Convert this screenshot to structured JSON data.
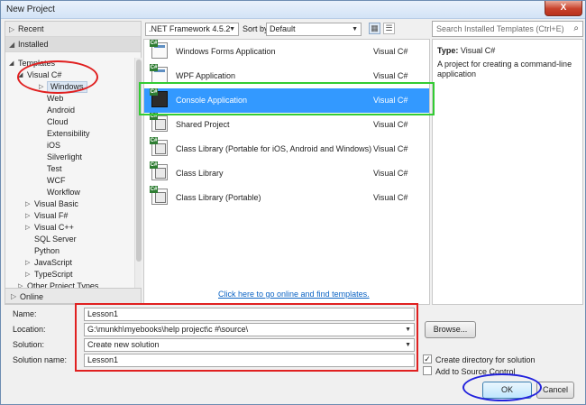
{
  "window": {
    "title": "New Project",
    "close_label": "X"
  },
  "left": {
    "recent_label": "Recent",
    "installed_label": "Installed",
    "online_label": "Online",
    "tree": [
      {
        "label": "Templates",
        "arrow": "◢"
      },
      {
        "label": "Visual C#",
        "arrow": "◢"
      },
      {
        "label": "Windows",
        "arrow": "▷",
        "selected": true
      },
      {
        "label": "Web"
      },
      {
        "label": "Android"
      },
      {
        "label": "Cloud"
      },
      {
        "label": "Extensibility"
      },
      {
        "label": "iOS"
      },
      {
        "label": "Silverlight"
      },
      {
        "label": "Test"
      },
      {
        "label": "WCF"
      },
      {
        "label": "Workflow"
      },
      {
        "label": "Visual Basic",
        "arrow": "▷"
      },
      {
        "label": "Visual F#",
        "arrow": "▷"
      },
      {
        "label": "Visual C++",
        "arrow": "▷"
      },
      {
        "label": "SQL Server"
      },
      {
        "label": "Python"
      },
      {
        "label": "JavaScript",
        "arrow": "▷"
      },
      {
        "label": "TypeScript",
        "arrow": "▷"
      },
      {
        "label": "Other Project Types",
        "arrow": "▷"
      }
    ]
  },
  "toolbar": {
    "framework_value": ".NET Framework 4.5.2",
    "sort_label": "Sort by:",
    "sort_value": "Default"
  },
  "templates": [
    {
      "name": "Windows Forms Application",
      "lang": "Visual C#",
      "icon": "winforms-app-icon"
    },
    {
      "name": "WPF Application",
      "lang": "Visual C#",
      "icon": "wpf-app-icon"
    },
    {
      "name": "Console Application",
      "lang": "Visual C#",
      "icon": "console-app-icon",
      "selected": true
    },
    {
      "name": "Shared Project",
      "lang": "Visual C#",
      "icon": "shared-project-icon"
    },
    {
      "name": "Class Library (Portable for iOS, Android and Windows)",
      "lang": "Visual C#",
      "icon": "portable-library-icon"
    },
    {
      "name": "Class Library",
      "lang": "Visual C#",
      "icon": "class-library-icon"
    },
    {
      "name": "Class Library (Portable)",
      "lang": "Visual C#",
      "icon": "portable-library-icon"
    }
  ],
  "online_link": "Click here to go online and find templates.",
  "search_placeholder": "Search Installed Templates (Ctrl+E)",
  "info": {
    "type_label": "Type:",
    "type_value": "Visual C#",
    "description": "A project for creating a command-line application"
  },
  "form": {
    "name_label": "Name:",
    "name_value": "Lesson1",
    "location_label": "Location:",
    "location_value": "G:\\munkh\\myebooks\\help project\\c #\\source\\",
    "solution_label": "Solution:",
    "solution_value": "Create new solution",
    "solution_name_label": "Solution name:",
    "solution_name_value": "Lesson1",
    "browse_label": "Browse...",
    "create_dir_label": "Create directory for solution",
    "create_dir_checked": true,
    "source_control_label": "Add to Source Control",
    "source_control_checked": false,
    "ok_label": "OK",
    "cancel_label": "Cancel"
  },
  "colors": {
    "selection": "#3399ff",
    "annotation_red": "#e02020",
    "annotation_green": "#33cc33",
    "annotation_blue": "#2222dd"
  }
}
